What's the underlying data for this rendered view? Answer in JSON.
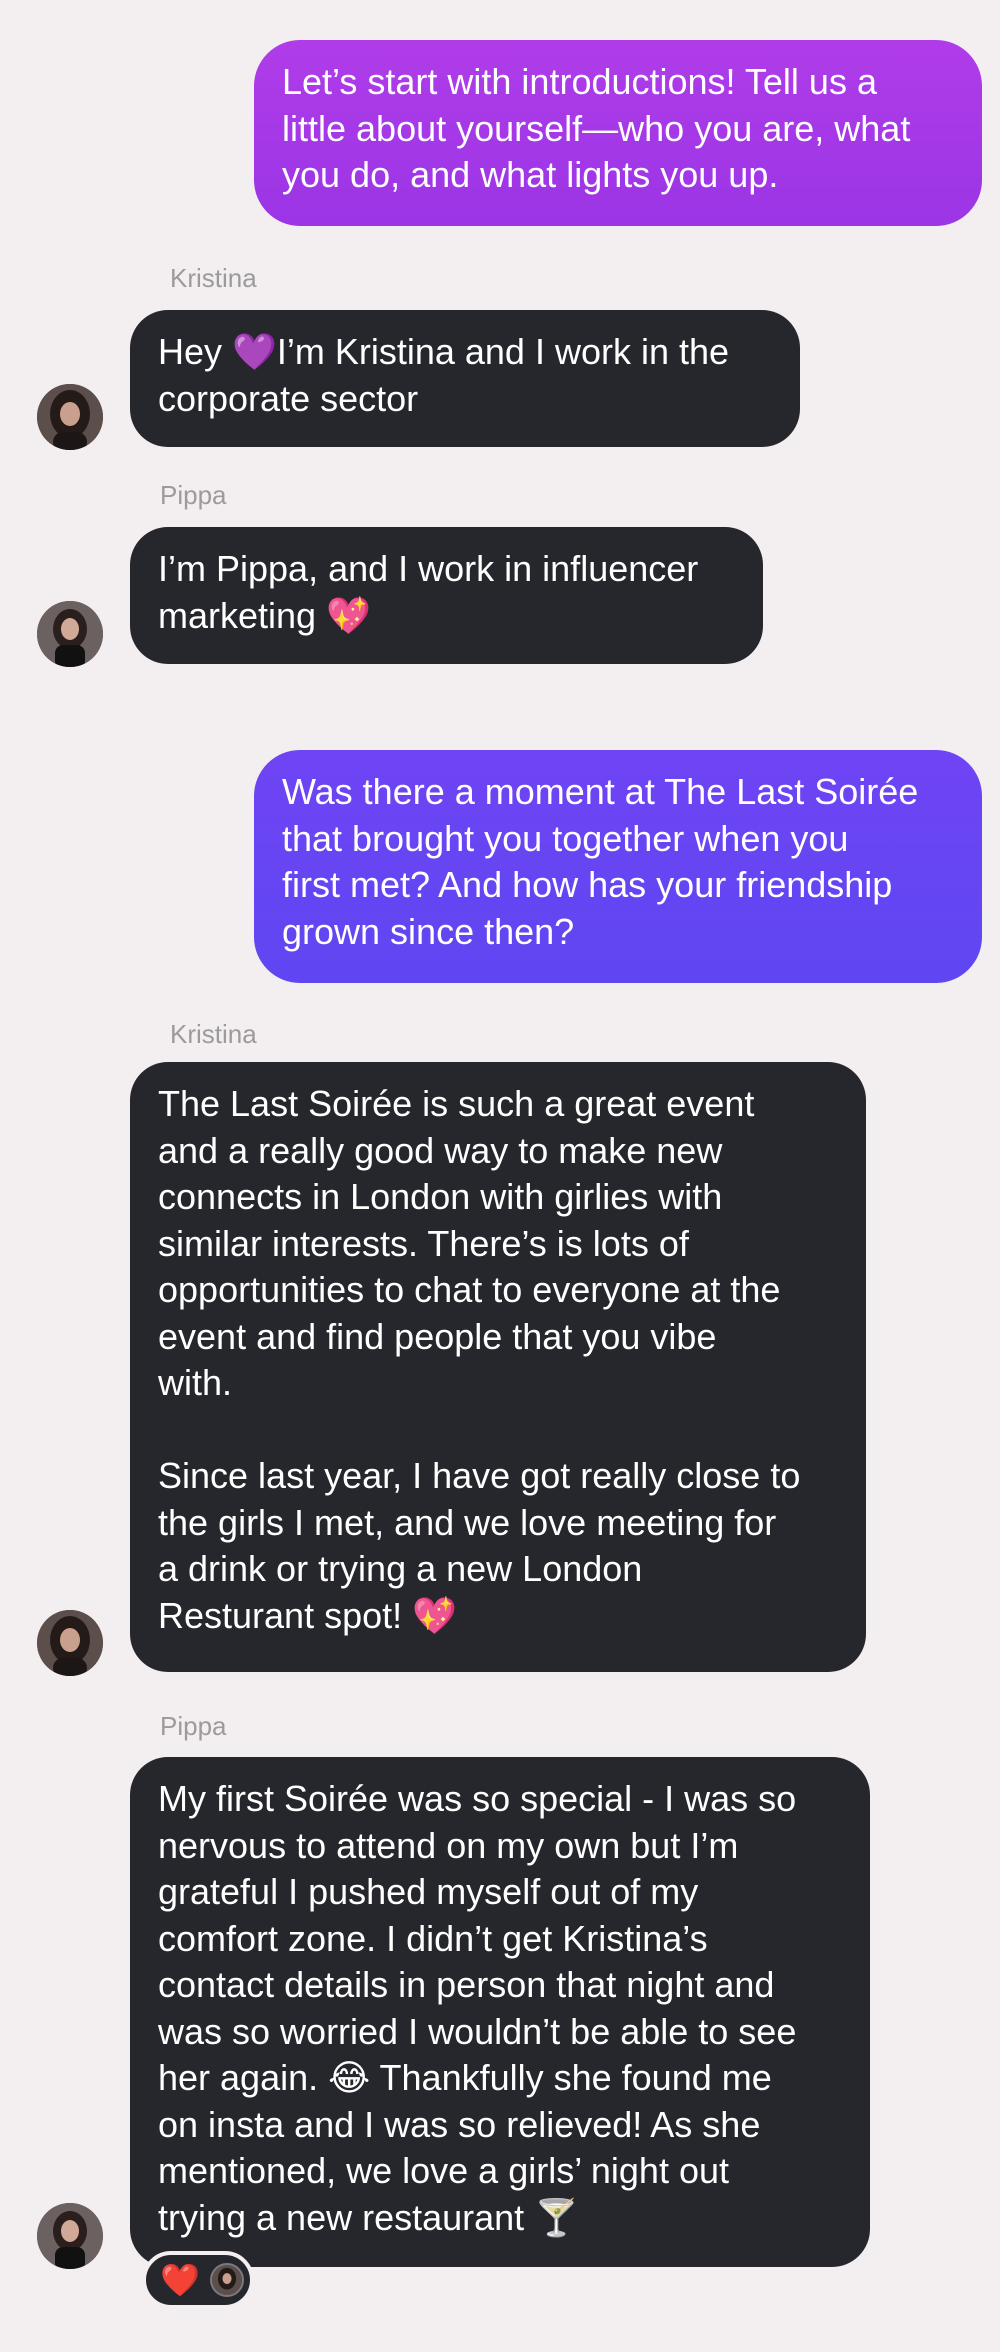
{
  "messages": [
    {
      "direction": "sent",
      "text": "Let’s start with introductions! Tell us a\nlittle about yourself—who you are, what\nyou do, and what lights you up."
    },
    {
      "direction": "received",
      "sender": "Kristina",
      "text": "Hey 💜I’m Kristina and I work in the\ncorporate sector"
    },
    {
      "direction": "received",
      "sender": "Pippa",
      "text": "I’m Pippa, and I work in influencer\nmarketing 💖"
    },
    {
      "direction": "sent",
      "text": "Was there a moment at The Last Soirée\nthat brought you together when you\nfirst met? And how has your friendship\ngrown since then?"
    },
    {
      "direction": "received",
      "sender": "Kristina",
      "text": "The Last Soirée is such a great event\nand a really good way to make new\nconnects in London with girlies with\nsimilar interests. There’s is lots of\nopportunities to chat to everyone at the\nevent and find people that you vibe\nwith.\n\nSince last year, I have got really close to\nthe girls I met, and we love meeting for\na drink or trying a new London\nResturant spot! 💖"
    },
    {
      "direction": "received",
      "sender": "Pippa",
      "text": "My first Soirée was so special - I was so\nnervous to attend on my own but I’m\ngrateful I pushed myself out of my\ncomfort zone. I didn’t get Kristina’s\ncontact details in person that night and\nwas so worried I wouldn’t be able to see\nher again. 😂 Thankfully she found me\non insta and I was so relieved! As she\nmentioned, we love a girls’ night out\ntrying a new restaurant 🍸"
    }
  ],
  "reaction": {
    "emoji": "❤️"
  },
  "colors": {
    "background": "#f3eff0",
    "received_bubble": "#26272c",
    "sent_bubble_1": "#a438e7",
    "sent_bubble_2": "#6645f3",
    "sender_label": "#9d9a9e"
  },
  "icons": {
    "avatar": "profile-photo",
    "reaction": "heart-emoji"
  }
}
